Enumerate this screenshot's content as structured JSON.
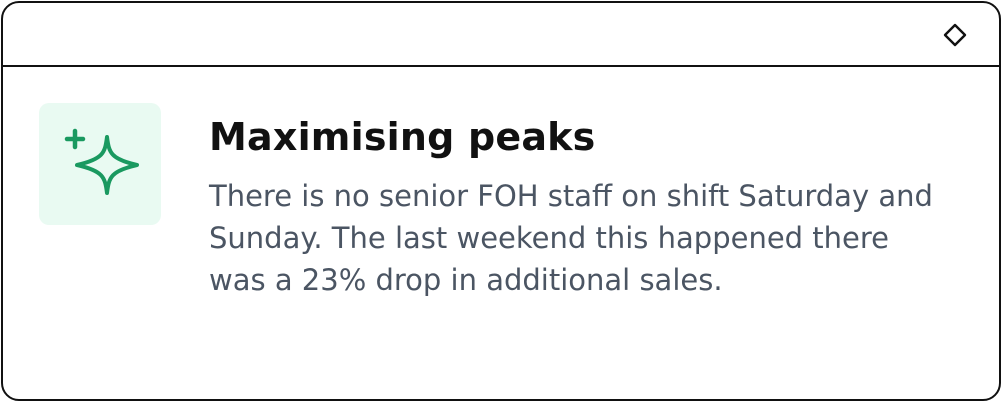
{
  "window": {
    "titlebar_icon": "diamond-icon"
  },
  "card": {
    "icon": "sparkle-icon",
    "icon_color": "#1a9960",
    "icon_bg": "#e9faf2",
    "title": "Maximising peaks",
    "description": "There is no senior FOH staff on shift Saturday and Sunday. The last weekend this happened there was a 23% drop in additional sales."
  }
}
